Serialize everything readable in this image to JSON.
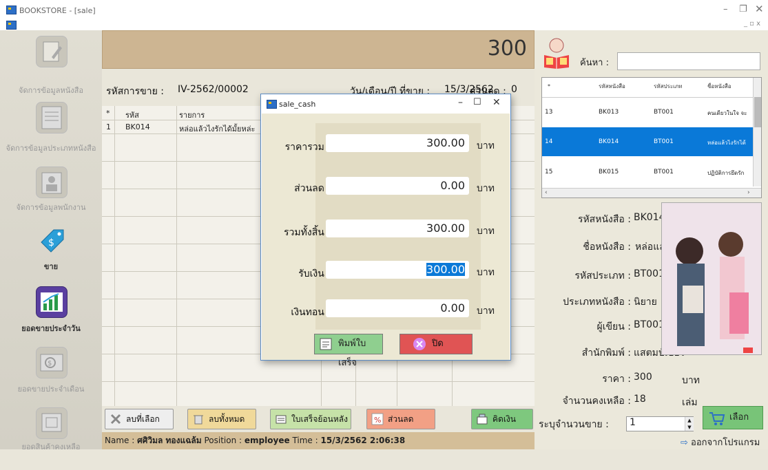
{
  "window": {
    "title": "BOOKSTORE - [sale]"
  },
  "sidebar": {
    "items": [
      {
        "label": "จัดการข้อมูลหนังสือ",
        "icon": "book-edit-icon"
      },
      {
        "label": "จัดการข้อมูลประเภทหนังสือ",
        "icon": "book-category-icon"
      },
      {
        "label": "จัดการข้อมูลพนักงาน",
        "icon": "employee-icon"
      },
      {
        "label": "ขาย",
        "icon": "price-tag-icon"
      },
      {
        "label": "ยอดขายประจำวัน",
        "icon": "daily-chart-icon"
      },
      {
        "label": "ยอดขายประจำเดือน",
        "icon": "monthly-money-icon"
      },
      {
        "label": "ยอดสินค้าคงเหลือ",
        "icon": "inventory-icon"
      }
    ]
  },
  "sale": {
    "total": "300",
    "invoice_label": "รหัสการขาย :",
    "invoice_no": "IV-2562/00002",
    "date_label": "วัน/เดือน/ปี ที่ขาย :",
    "date": "15/3/2562",
    "discount_label": "ส่วนลด :",
    "discount": "0",
    "columns": [
      "*",
      "รหัส",
      "รายการ"
    ],
    "rows": [
      {
        "index": "1",
        "code": "BK014",
        "item": "หล่อแล้วไงรักได้มั้ยหล่ะ"
      }
    ]
  },
  "actions": {
    "delete_selected": "ลบที่เลือก",
    "delete_all": "ลบทั้งหมด",
    "reprint": "ใบเสร็จย้อนหลัง",
    "discount": "ส่วนลด",
    "checkout": "คิดเงิน"
  },
  "status": {
    "name_label": "Name :",
    "name": "ศศิวิมล ทองแฉล้ม",
    "position_label": "Position :",
    "position": "employee",
    "time_label": "Time :",
    "time": "15/3/2562 2:06:38"
  },
  "search": {
    "label": "ค้นหา :",
    "value": ""
  },
  "book_grid": {
    "columns": [
      "*",
      "รหัสหนังสือ",
      "รหัสประเภท",
      "ชื่อหนังสือ"
    ],
    "rows": [
      {
        "no": "13",
        "code": "BK013",
        "type": "BT001",
        "name": "คนเดียวในใจ จะ"
      },
      {
        "no": "14",
        "code": "BK014",
        "type": "BT001",
        "name": "หล่อแล้วไงรักได้"
      },
      {
        "no": "15",
        "code": "BK015",
        "type": "BT001",
        "name": "ปฏิบัติการยึดรัก"
      }
    ]
  },
  "book_detail": {
    "code_label": "รหัสหนังสือ :",
    "code": "BK014",
    "name_label": "ชื่อหนังสือ :",
    "name": "หล่อแล้วไงรักได้มั้ยหล่ะ",
    "type_label": "รหัสประเภท :",
    "type": "BT001",
    "category_label": "ประเภทหนังสือ :",
    "category": "นิยาย",
    "author_label": "ผู้เขียน :",
    "author": "BT001",
    "publisher_label": "สำนักพิมพ์ :",
    "publisher": "แสตมป์เบอรี่",
    "price_label": "ราคา :",
    "price": "300",
    "price_unit": "บาท",
    "stock_label": "จำนวนคงเหลือ :",
    "stock": "18",
    "stock_unit": "เล่ม",
    "qty_label": "ระบุจำนวนขาย :",
    "qty": "1",
    "qty_unit": "เล่ม",
    "select_button": "เลือก",
    "exit_button": "ออกจากโปรแกรม"
  },
  "dialog": {
    "title": "sale_cash",
    "total_label": "ราคารวม :",
    "total": "300.00",
    "discount_label": "ส่วนลด :",
    "discount": "0.00",
    "net_label": "รวมทั้งสิ้น :",
    "net": "300.00",
    "received_label": "รับเงิน :",
    "received": "300.00",
    "change_label": "เงินทอน :",
    "change": "0.00",
    "unit": "บาท",
    "print_button": "พิมพ์ใบเสร็จ",
    "close_button": "ปิด"
  },
  "colors": {
    "accent_blue": "#0a79d8",
    "checkout_green": "#7ec87e",
    "close_red": "#e05454"
  }
}
